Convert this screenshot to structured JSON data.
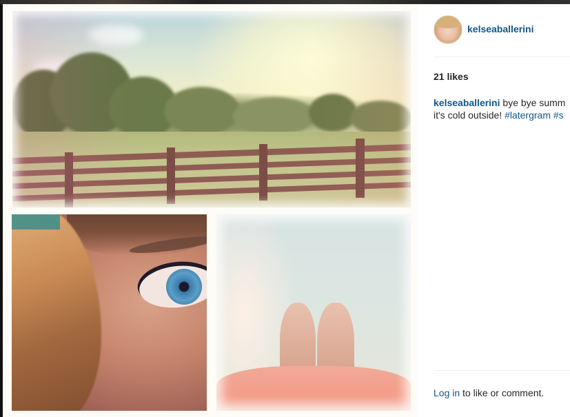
{
  "post": {
    "username": "kelseaballerini",
    "likes": "21 likes",
    "caption": {
      "user": "kelseaballerini",
      "line1_text": " bye bye summ",
      "line2_text": "it's cold outside! ",
      "hashtag1": "#latergram",
      "hashtag2": " #s"
    },
    "login_link": "Log in",
    "login_text": " to like or comment."
  },
  "photo": {
    "tiles": [
      "landscape with wooden fence",
      "close-up of blue eye",
      "bare feet on pale floor"
    ]
  },
  "colors": {
    "link": "#125688",
    "text": "#262626",
    "divider": "#efefef"
  }
}
